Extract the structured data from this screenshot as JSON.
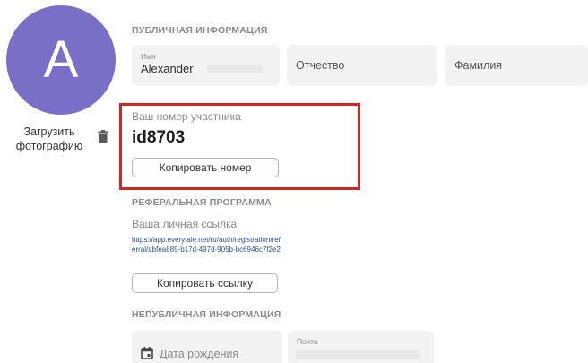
{
  "avatar": {
    "letter": "A",
    "color": "#7a6fc7"
  },
  "upload_photo_label": "Загрузить фотографию",
  "icons": {
    "delete": "trash-icon",
    "date": "calendar-icon"
  },
  "public_info": {
    "title": "ПУБЛИЧНАЯ ИНФОРМАЦИЯ",
    "name": {
      "label": "Имя",
      "value": "Alexander"
    },
    "patronymic": {
      "placeholder": "Отчество"
    },
    "surname": {
      "placeholder": "Фамилия"
    }
  },
  "member": {
    "label": "Ваш номер участника",
    "id": "id8703",
    "copy_button": "Копировать номер",
    "highlight_color": "#d0262a"
  },
  "referral": {
    "title": "РЕФЕРАЛЬНАЯ ПРОГРАММА",
    "link_label": "Ваша личная ссылка",
    "link": "https://app.everytale.net/ru/auth/registration/referral/abfea889-b17d-497d-905b-bc6946c7f2e2",
    "copy_button": "Копировать ссылку"
  },
  "private_info": {
    "title": "НЕПУБЛИЧНАЯ ИНФОРМАЦИЯ",
    "birth_date": {
      "placeholder": "Дата рождения"
    },
    "email": {
      "label": "Почта"
    }
  }
}
